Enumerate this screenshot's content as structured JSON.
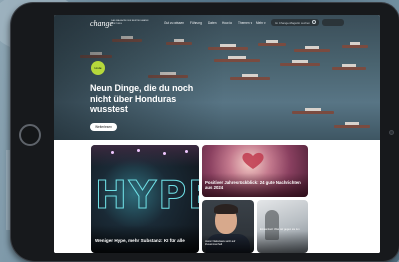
{
  "site": {
    "logo": "change",
    "logo_subtitle": "DAS MAGAZIN DER BERTELSMANN STIFTUNG"
  },
  "nav": {
    "items": [
      "Gut zu wissen",
      "Führung",
      "Daten",
      "How-to",
      "Themen ▾",
      "Mehr ▾"
    ],
    "search_placeholder": "Im Change-Magazin suchen"
  },
  "hero": {
    "tag": "Liste",
    "title": "Neun Dinge, die du noch nicht über Honduras wusstest",
    "button_label": "Weiterlesen"
  },
  "cards": [
    {
      "title": "Weniger Hype, mehr Substanz: KI für alle"
    },
    {
      "title": "Positiver Jahresrückblick: 24 gute Nachrichten aus 2024"
    },
    {
      "title": "Jason Nakazawa setzt auf Zusammenhalt"
    },
    {
      "title": "Einsamkeit: Was wir gegen sie tun"
    }
  ]
}
